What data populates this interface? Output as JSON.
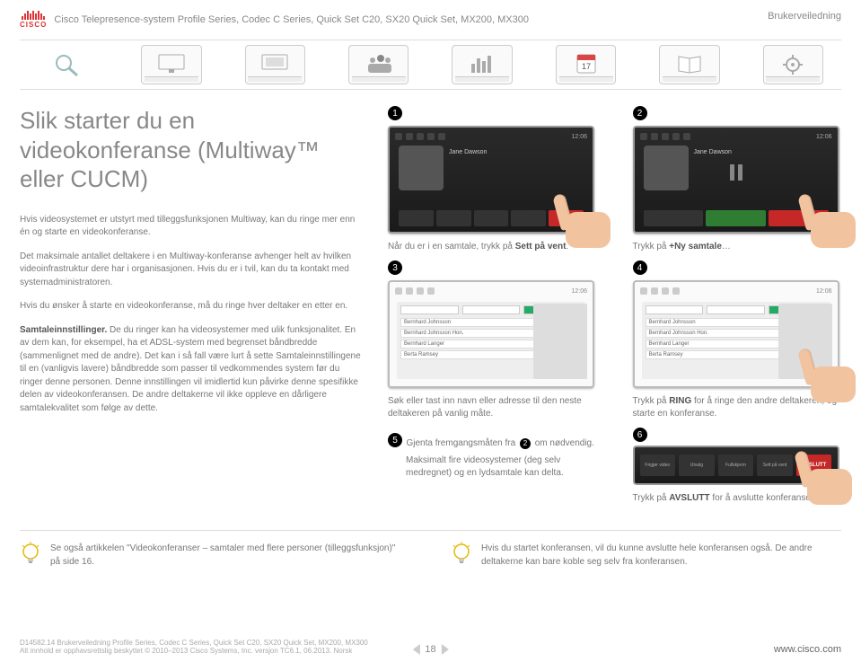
{
  "header": {
    "product_line": "Cisco Telepresence-system Profile Series, Codec C Series, Quick Set C20, SX20 Quick Set, MX200, MX300",
    "guide_label": "Brukerveiledning"
  },
  "nav": {
    "items": [
      "search",
      "screen1",
      "screen2",
      "people",
      "chart",
      "calendar",
      "book",
      "settings"
    ],
    "cal_day": "17"
  },
  "title": "Slik starter du en videokonferanse (Multiway™ eller CUCM)",
  "paragraphs": {
    "p1": "Hvis videosystemet er utstyrt med tilleggsfunksjonen Multiway, kan du ringe mer enn én og starte en videokonferanse.",
    "p2": "Det maksimale antallet deltakere i en Multiway-konferanse avhenger helt av hvilken videoinfrastruktur dere har i organisasjonen. Hvis du er i tvil, kan du ta kontakt med systemadministratoren.",
    "p3": "Hvis du ønsker å starte en videokonferanse, må du ringe hver deltaker en etter en.",
    "p4_label": "Samtaleinnstillinger.",
    "p4": " De du ringer kan ha videosystemer med ulik funksjonalitet. En av dem kan, for eksempel, ha et ADSL-system med begrenset båndbredde (sammenlignet med de andre). Det kan i så fall være lurt å sette Samtaleinnstillingene til en (vanligvis lavere) båndbredde som passer til vedkommendes system før du ringer denne personen. Denne innstillingen vil imidlertid kun påvirke denne spesifikke delen av videokonferansen. De andre deltakerne vil ikke oppleve en dårligere samtalekvalitet som følge av dette."
  },
  "steps": {
    "s1_num": "1",
    "s1_name": "Jane Dawson",
    "s1_caption_a": "Når du er i en samtale, trykk på ",
    "s1_caption_b": "Sett på vent",
    "s2_num": "2",
    "s2_name": "Jane Dawson",
    "s2_caption_a": "Trykk på ",
    "s2_caption_b": "+Ny samtale",
    "s2_caption_c": "…",
    "s3_num": "3",
    "s3_caption": "Søk eller tast inn navn eller adresse til den neste deltakeren på vanlig måte.",
    "s4_num": "4",
    "s4_caption_a": "Trykk på ",
    "s4_caption_b": "RING",
    "s4_caption_c": " for å ringe den andre deltakeren, og starte en konferanse.",
    "s5_num": "5",
    "s5_caption_a": "Gjenta fremgangsmåten fra ",
    "s5_ref": "2",
    "s5_caption_b": " om nødvendig.",
    "s5_caption_c": "Maksimalt fire videosystemer (deg selv medregnet) og en lydsamtale kan delta.",
    "s6_num": "6",
    "s6_caption_a": "Trykk på ",
    "s6_caption_b": "AVSLUTT",
    "s6_caption_c": " for å avslutte konferansen.",
    "s6_btn": "AVSLUTT",
    "time": "12:06"
  },
  "tips": {
    "t1": "Se også artikkelen \"Videokonferanser – samtaler med flere personer (tilleggsfunksjon)\" på side 16.",
    "t2": "Hvis du startet konferansen, vil du kunne avslutte hele konferansen også. De andre deltakerne kan bare koble seg selv fra konferansen."
  },
  "footer": {
    "line1": "D14582.14 Brukerveiledning Profile Series, Codec C Series, Quick Set C20, SX20 Quick Set, MX200, MX300",
    "line2": "Alt innhold er opphavsrettslig beskyttet © 2010–2013 Cisco Systems, Inc. versjon TC6.1, 06.2013. Norsk",
    "page": "18",
    "url": "www.cisco.com"
  }
}
